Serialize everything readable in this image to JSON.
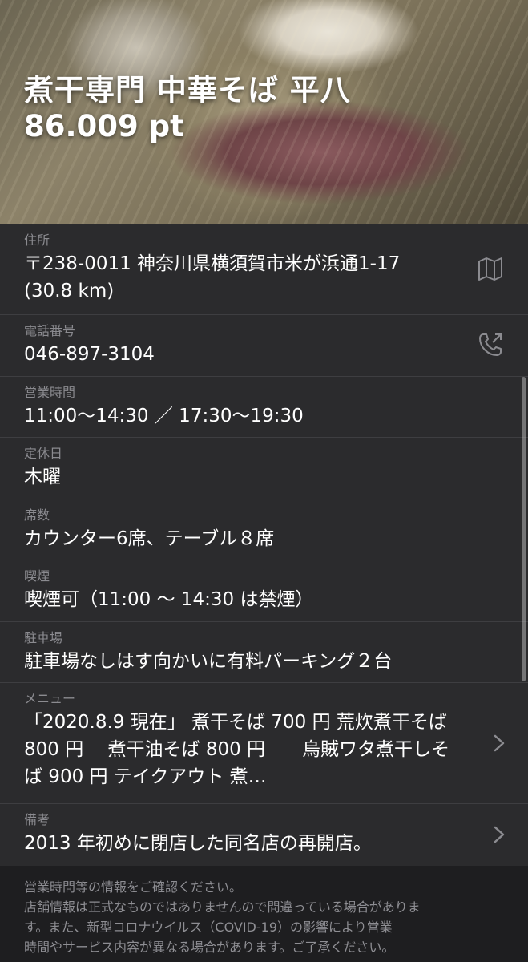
{
  "header": {
    "title": "煮干専門 中華そば 平八",
    "score": "86.009 pt"
  },
  "fields": {
    "address": {
      "label": "住所",
      "line1": "〒238-0011 神奈川県横須賀市米が浜通1-17",
      "line2": "(30.8 km)",
      "icon": "map-icon"
    },
    "phone": {
      "label": "電話番号",
      "value": "046-897-3104",
      "icon": "phone-icon"
    },
    "hours": {
      "label": "営業時間",
      "value": "11:00〜14:30 ／ 17:30〜19:30"
    },
    "closed": {
      "label": "定休日",
      "value": "木曜"
    },
    "seats": {
      "label": "席数",
      "value": "カウンター6席、テーブル８席"
    },
    "smoking": {
      "label": "喫煙",
      "value": "喫煙可（11:00 〜 14:30 は禁煙）"
    },
    "parking": {
      "label": "駐車場",
      "value": "駐車場なしはす向かいに有料パーキング２台"
    },
    "menu": {
      "label": "メニュー",
      "value": "「2020.8.9 現在」 煮干そば 700 円 荒炊煮干そば 800 円　 煮干油そば  800 円　　烏賊ワタ煮干しそば 900 円 テイクアウト 煮…",
      "icon": "chevron-right-icon"
    },
    "notes": {
      "label": "備考",
      "value": "2013 年初めに閉店した同名店の再開店。",
      "icon": "chevron-right-icon"
    }
  },
  "footer": {
    "line1": "営業時間等の情報をご確認ください。",
    "line2": "店舗情報は正式なものではありませんので間違っている場合がありま",
    "line3": "す。また、新型コロナウイルス（COVID-19）の影響により営業",
    "line4": "時間やサービス内容が異なる場合があります。ご了承ください。"
  }
}
